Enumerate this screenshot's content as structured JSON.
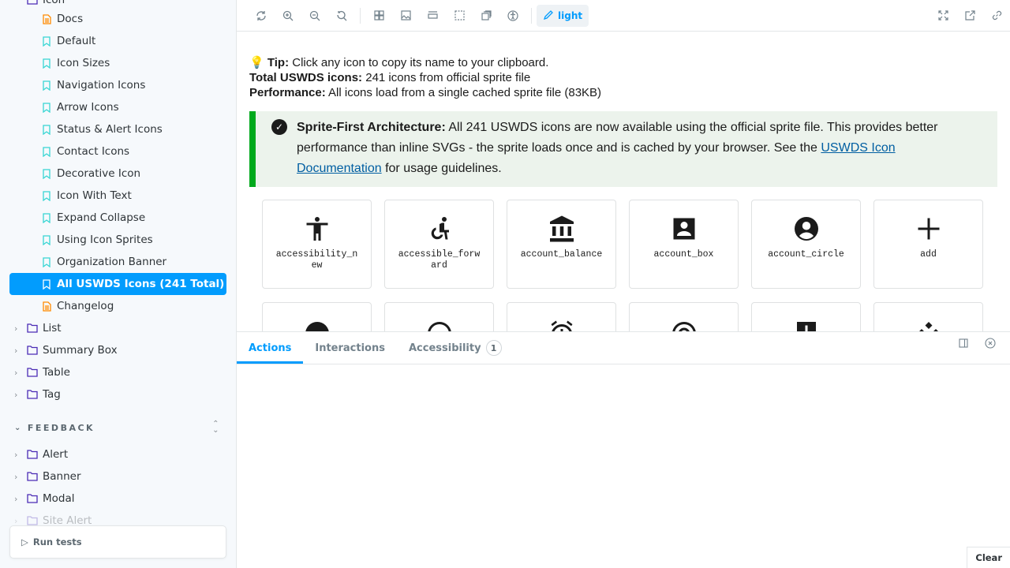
{
  "sidebar": {
    "top_partial": "Icon",
    "icon_children": [
      {
        "label": "Docs",
        "type": "doc"
      },
      {
        "label": "Default",
        "type": "story"
      },
      {
        "label": "Icon Sizes",
        "type": "story"
      },
      {
        "label": "Navigation Icons",
        "type": "story"
      },
      {
        "label": "Arrow Icons",
        "type": "story"
      },
      {
        "label": "Status & Alert Icons",
        "type": "story"
      },
      {
        "label": "Contact Icons",
        "type": "story"
      },
      {
        "label": "Decorative Icon",
        "type": "story"
      },
      {
        "label": "Icon With Text",
        "type": "story"
      },
      {
        "label": "Expand Collapse",
        "type": "story"
      },
      {
        "label": "Using Icon Sprites",
        "type": "story"
      },
      {
        "label": "Organization Banner",
        "type": "story"
      },
      {
        "label": "All USWDS Icons (241 Total)",
        "type": "story",
        "selected": true
      },
      {
        "label": "Changelog",
        "type": "doc"
      }
    ],
    "folders": [
      "List",
      "Summary Box",
      "Table",
      "Tag"
    ],
    "section_title": "FEEDBACK",
    "feedback_folders": [
      "Alert",
      "Banner",
      "Modal",
      "Site Alert"
    ],
    "run_tests": "Run tests"
  },
  "toolbar": {
    "theme_label": "light"
  },
  "preview": {
    "tip_label": "Tip:",
    "tip_text": " Click any icon to copy its name to your clipboard.",
    "total_label": "Total USWDS icons:",
    "total_text": " 241 icons from official sprite file",
    "perf_label": "Performance:",
    "perf_text": " All icons load from a single cached sprite file (83KB)",
    "alert": {
      "bold": "Sprite-First Architecture:",
      "text": " All 241 USWDS icons are now available using the official sprite file. This provides better performance than inline SVGs - the sprite loads once and is cached by your browser. See the ",
      "link": "USWDS Icon Documentation",
      "after": " for usage guidelines."
    },
    "icons": [
      {
        "name": "accessibility_new"
      },
      {
        "name": "accessible_forward"
      },
      {
        "name": "account_balance"
      },
      {
        "name": "account_box"
      },
      {
        "name": "account_circle"
      },
      {
        "name": "add"
      },
      {
        "name": ""
      },
      {
        "name": ""
      },
      {
        "name": ""
      },
      {
        "name": ""
      },
      {
        "name": ""
      },
      {
        "name": ""
      }
    ]
  },
  "panel": {
    "tabs": [
      "Actions",
      "Interactions",
      "Accessibility"
    ],
    "accessibility_count": "1",
    "clear": "Clear"
  },
  "colors": {
    "accent": "#029cfd",
    "success": "#00a91c",
    "folder": "#4b2bb5",
    "story": "#37d5d3",
    "doc": "#ff8a00"
  }
}
